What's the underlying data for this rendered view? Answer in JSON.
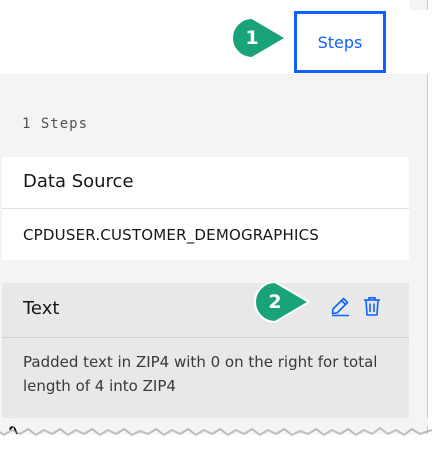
{
  "header": {
    "steps_tab_label": "Steps"
  },
  "callouts": [
    {
      "number": "1",
      "color": "#1aa37a"
    },
    {
      "number": "2",
      "color": "#1aa37a"
    }
  ],
  "steps_panel": {
    "count_label": "1 Steps",
    "cards": [
      {
        "title": "Data Source",
        "value": "CPDUSER.CUSTOMER_DEMOGRAPHICS"
      },
      {
        "title": "Text",
        "description": "Padded text in ZIP4 with 0 on the right for total length of 4 into ZIP4",
        "actions": [
          {
            "icon": "edit-icon"
          },
          {
            "icon": "trash-icon"
          }
        ]
      }
    ]
  },
  "colors": {
    "accent": "#0f62fe",
    "callout": "#1aa37a",
    "panel_bg": "#f4f4f4",
    "selected_card_bg": "#e8e8e8"
  }
}
